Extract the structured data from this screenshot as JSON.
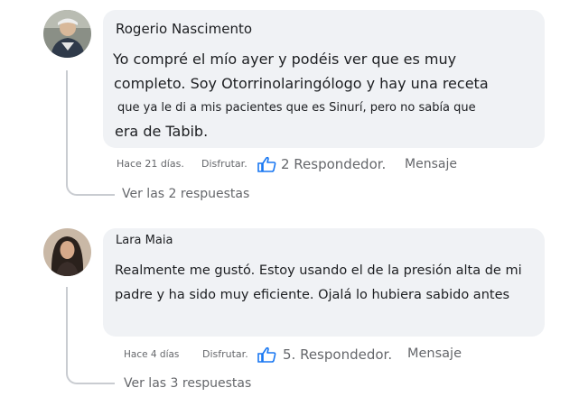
{
  "comments": [
    {
      "author": "Rogerio Nascimento",
      "lines": [
        "Yo compré el mío ayer y podéis ver que es muy",
        "completo. Soy Otorrinolaringólogo y hay una receta",
        "que ya le di a mis pacientes que es Sinurí, pero no sabía que",
        "era de Tabib."
      ],
      "time": "Hace 21 días.",
      "like": "Disfrutar.",
      "replies_count": "2 Respondedor.",
      "message": "Mensaje",
      "view_replies": "Ver las 2 respuestas"
    },
    {
      "author": "Lara Maia",
      "lines": [
        "Realmente me gustó. Estoy usando el de la presión alta de mi",
        "padre y ha sido muy eficiente. Ojalá lo hubiera sabido antes"
      ],
      "time": "Hace 4 días",
      "like": "Disfrutar.",
      "replies_count": "5. Respondedor.",
      "message": "Mensaje",
      "view_replies": "Ver las 3 respuestas"
    }
  ],
  "colors": {
    "bubble": "#f0f2f5",
    "meta_text": "#65676b",
    "thumb": "#1877f2",
    "connector": "#c9ccd1"
  },
  "icons": [
    "thumbs-up-icon"
  ]
}
